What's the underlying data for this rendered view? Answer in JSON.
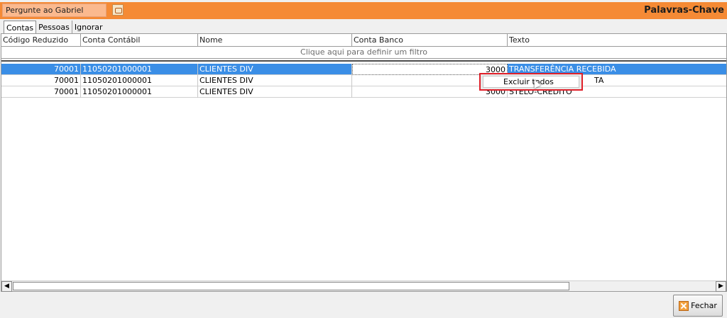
{
  "top": {
    "ask_placeholder": "Pergunte ao Gabriel",
    "title": "Palavras-Chave"
  },
  "tabs": [
    {
      "label": "Contas",
      "active": true
    },
    {
      "label": "Pessoas",
      "active": false
    },
    {
      "label": "Ignorar",
      "active": false
    }
  ],
  "grid": {
    "columns": [
      "Código Reduzido",
      "Conta Contábil",
      "Nome",
      "Conta Banco",
      "Texto"
    ],
    "filter_hint": "Clique aqui para definir um filtro",
    "rows": [
      {
        "codigo": "70001",
        "conta": "11050201000001",
        "nome": "CLIENTES DIV",
        "banco": "3000",
        "texto": "TRANSFERÊNCIA RECEBIDA",
        "selected": true
      },
      {
        "codigo": "70001",
        "conta": "11050201000001",
        "nome": "CLIENTES DIV",
        "banco": "",
        "texto": "TA",
        "selected": false
      },
      {
        "codigo": "70001",
        "conta": "11050201000001",
        "nome": "CLIENTES DIV",
        "banco": "3000",
        "texto": "STELO-CRÉDITO",
        "selected": false
      }
    ]
  },
  "context_menu": {
    "items": [
      "Excluir todos"
    ]
  },
  "footer": {
    "close_label": "Fechar"
  },
  "icons": {
    "ask": "assistant-icon",
    "close": "close-icon",
    "scroll_left": "arrow-left-icon",
    "scroll_right": "arrow-right-icon"
  },
  "colors": {
    "topbar": "#f58a35",
    "selection": "#3a8ee6",
    "menu_highlight_border": "#e0202a"
  }
}
